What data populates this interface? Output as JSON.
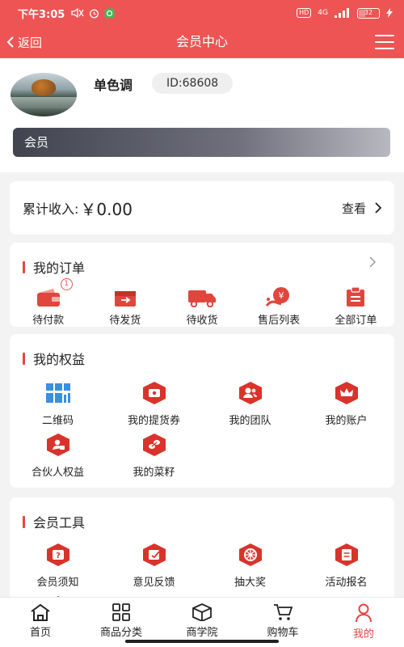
{
  "status_bar": {
    "time": "下午3:05",
    "hd": "HD",
    "network": "4G",
    "battery": "32",
    "battery_level": 0.32
  },
  "navbar": {
    "back_label": "返回",
    "title": "会员中心"
  },
  "profile": {
    "username": "单色调",
    "id_text": "ID:68608",
    "member_label": "会员"
  },
  "income": {
    "label": "累计收入:",
    "amount": "￥0.00",
    "view_label": "查看"
  },
  "orders": {
    "title": "我的订单",
    "items": [
      {
        "label": "待付款",
        "icon": "wallet-icon",
        "badge": "1"
      },
      {
        "label": "待发货",
        "icon": "box-icon"
      },
      {
        "label": "待收货",
        "icon": "truck-icon"
      },
      {
        "label": "售后列表",
        "icon": "refund-icon"
      },
      {
        "label": "全部订单",
        "icon": "clipboard-icon"
      }
    ]
  },
  "rights": {
    "title": "我的权益",
    "items": [
      {
        "label": "二维码",
        "icon": "qrcode-icon"
      },
      {
        "label": "我的提货券",
        "icon": "coupon-icon"
      },
      {
        "label": "我的团队",
        "icon": "team-icon"
      },
      {
        "label": "我的账户",
        "icon": "crown-icon"
      },
      {
        "label": "合伙人权益",
        "icon": "partner-icon"
      },
      {
        "label": "我的菜籽",
        "icon": "seed-icon"
      }
    ]
  },
  "tools": {
    "title": "会员工具",
    "items": [
      {
        "label": "会员须知",
        "icon": "question-icon"
      },
      {
        "label": "意见反馈",
        "icon": "feedback-icon"
      },
      {
        "label": "抽大奖",
        "icon": "wheel-icon"
      },
      {
        "label": "活动报名",
        "icon": "signup-icon"
      }
    ]
  },
  "tabbar": {
    "items": [
      {
        "label": "首页",
        "icon": "home-icon"
      },
      {
        "label": "商品分类",
        "icon": "category-icon"
      },
      {
        "label": "商学院",
        "icon": "school-icon"
      },
      {
        "label": "购物车",
        "icon": "cart-icon"
      },
      {
        "label": "我的",
        "icon": "user-icon",
        "active": true
      }
    ]
  },
  "colors": {
    "brand": "#ee5454",
    "accent": "#e84545",
    "icon_red": "#d9332b"
  }
}
